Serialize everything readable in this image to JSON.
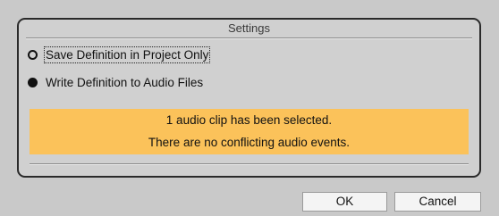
{
  "dialog": {
    "title": "Settings",
    "options": [
      {
        "label": "Save Definition in Project Only",
        "selected": false
      },
      {
        "label": "Write Definition to Audio Files",
        "selected": true
      }
    ],
    "info": {
      "line1": "1 audio clip has been selected.",
      "line2": "There are no conflicting audio events.",
      "color": "#fbc25a"
    }
  },
  "buttons": {
    "ok": "OK",
    "cancel": "Cancel"
  }
}
